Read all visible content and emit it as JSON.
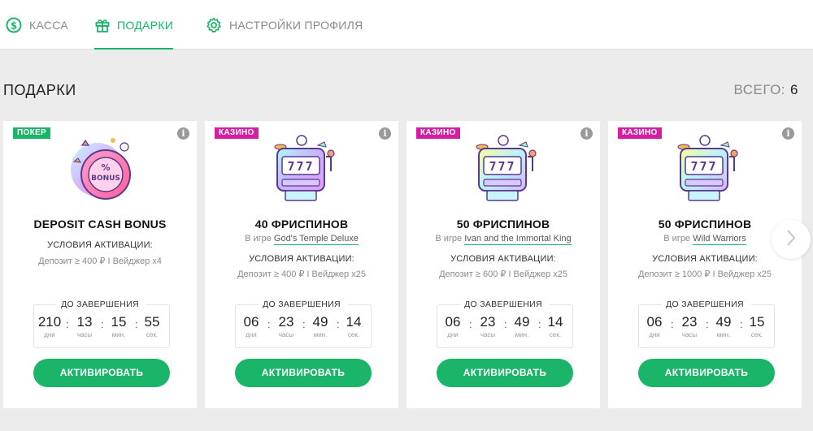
{
  "nav": {
    "tabs": [
      {
        "label": "КАССА",
        "icon": "dollar-coin-icon",
        "active": false
      },
      {
        "label": "ПОДАРКИ",
        "icon": "gift-icon",
        "active": true
      },
      {
        "label": "НАСТРОЙКИ ПРОФИЛЯ",
        "icon": "gear-icon",
        "active": false
      }
    ]
  },
  "section": {
    "title": "ПОДАРКИ",
    "total_label": "ВСЕГО:",
    "total_value": "6"
  },
  "colors": {
    "accent": "#1bb56a",
    "casino_badge": "#d61ea5",
    "poker_badge": "#1bb56a"
  },
  "cards": [
    {
      "badge": "ПОКЕР",
      "title": "DEPOSIT CASH BONUS",
      "game_prefix": "",
      "game_name": "",
      "conditions_title": "УСЛОВИЯ АКТИВАЦИИ:",
      "conditions": "Депозит ≥ 400 ₽ I Вейджер x4",
      "countdown_label": "ДО ЗАВЕРШЕНИЯ",
      "timer": {
        "days": "210",
        "hours": "13",
        "minutes": "15",
        "seconds": "55"
      },
      "units": {
        "days": "дни",
        "hours": "часы",
        "minutes": "мин.",
        "seconds": "сек."
      },
      "button": "АКТИВИРОВАТЬ",
      "art_text": "BONUS",
      "art_percent": "%"
    },
    {
      "badge": "КАЗИНО",
      "title": "40 ФРИСПИНОВ",
      "game_prefix": "В игре",
      "game_name": "God's Temple Deluxe",
      "conditions_title": "УСЛОВИЯ АКТИВАЦИИ:",
      "conditions": "Депозит ≥ 400 ₽ I Вейджер x25",
      "countdown_label": "ДО ЗАВЕРШЕНИЯ",
      "timer": {
        "days": "06",
        "hours": "23",
        "minutes": "49",
        "seconds": "14"
      },
      "units": {
        "days": "дни",
        "hours": "часы",
        "minutes": "мин.",
        "seconds": "сек."
      },
      "button": "АКТИВИРОВАТЬ",
      "art_text": "777"
    },
    {
      "badge": "КАЗИНО",
      "title": "50 ФРИСПИНОВ",
      "game_prefix": "В игре",
      "game_name": "Ivan and the Immortal King",
      "conditions_title": "УСЛОВИЯ АКТИВАЦИИ:",
      "conditions": "Депозит ≥ 600 ₽ I Вейджер x25",
      "countdown_label": "ДО ЗАВЕРШЕНИЯ",
      "timer": {
        "days": "06",
        "hours": "23",
        "minutes": "49",
        "seconds": "14"
      },
      "units": {
        "days": "дни",
        "hours": "часы",
        "minutes": "мин.",
        "seconds": "сек."
      },
      "button": "АКТИВИРОВАТЬ",
      "art_text": "777"
    },
    {
      "badge": "КАЗИНО",
      "title": "50 ФРИСПИНОВ",
      "game_prefix": "В игре",
      "game_name": "Wild Warriors",
      "conditions_title": "УСЛОВИЯ АКТИВАЦИИ:",
      "conditions": "Депозит ≥ 1000 ₽ I Вейджер x25",
      "countdown_label": "ДО ЗАВЕРШЕНИЯ",
      "timer": {
        "days": "06",
        "hours": "23",
        "minutes": "49",
        "seconds": "15"
      },
      "units": {
        "days": "дни",
        "hours": "часы",
        "minutes": "мин.",
        "seconds": "сек."
      },
      "button": "АКТИВИРОВАТЬ",
      "art_text": "777"
    }
  ]
}
